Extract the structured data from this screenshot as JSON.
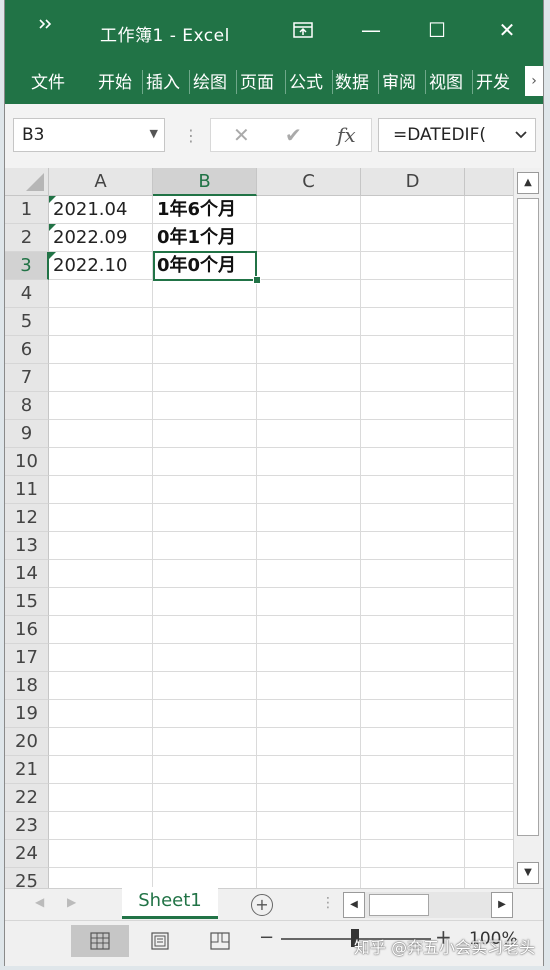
{
  "titlebar": {
    "qat_icon": "customize-qat-icon",
    "title": "工作簿1  -  Excel",
    "minimize": "—",
    "maximize": "☐",
    "close": "✕"
  },
  "ribbon": {
    "tabs": [
      "文件",
      "开始",
      "插入",
      "绘图",
      "页面",
      "公式",
      "数据",
      "审阅",
      "视图",
      "开发"
    ],
    "scroll": "›"
  },
  "formula_bar": {
    "name_box": "B3",
    "cancel": "✕",
    "enter": "✔",
    "fx": "fx",
    "formula": "=DATEDIF("
  },
  "columns": [
    "A",
    "B",
    "C",
    "D"
  ],
  "selected_cell": {
    "column": "B",
    "row": 3
  },
  "rows": [
    {
      "num": "1",
      "A": "2021.04",
      "B": "1年6个月"
    },
    {
      "num": "2",
      "A": "2022.09",
      "B": "0年1个月"
    },
    {
      "num": "3",
      "A": "2022.10",
      "B": "0年0个月"
    },
    {
      "num": "4"
    },
    {
      "num": "5"
    },
    {
      "num": "6"
    },
    {
      "num": "7"
    },
    {
      "num": "8"
    },
    {
      "num": "9"
    },
    {
      "num": "10"
    },
    {
      "num": "11"
    },
    {
      "num": "12"
    },
    {
      "num": "13"
    },
    {
      "num": "14"
    },
    {
      "num": "15"
    },
    {
      "num": "16"
    },
    {
      "num": "17"
    },
    {
      "num": "18"
    },
    {
      "num": "19"
    },
    {
      "num": "20"
    },
    {
      "num": "21"
    },
    {
      "num": "22"
    },
    {
      "num": "23"
    },
    {
      "num": "24"
    },
    {
      "num": "25"
    }
  ],
  "sheets": {
    "active": "Sheet1",
    "add": "+"
  },
  "status": {
    "zoom_minus": "−",
    "zoom_plus": "+",
    "zoom": "100%",
    "zoom_level": 1.0
  },
  "watermark": "知乎 @奔五小会实习老头",
  "colors": {
    "accent": "#217346"
  }
}
